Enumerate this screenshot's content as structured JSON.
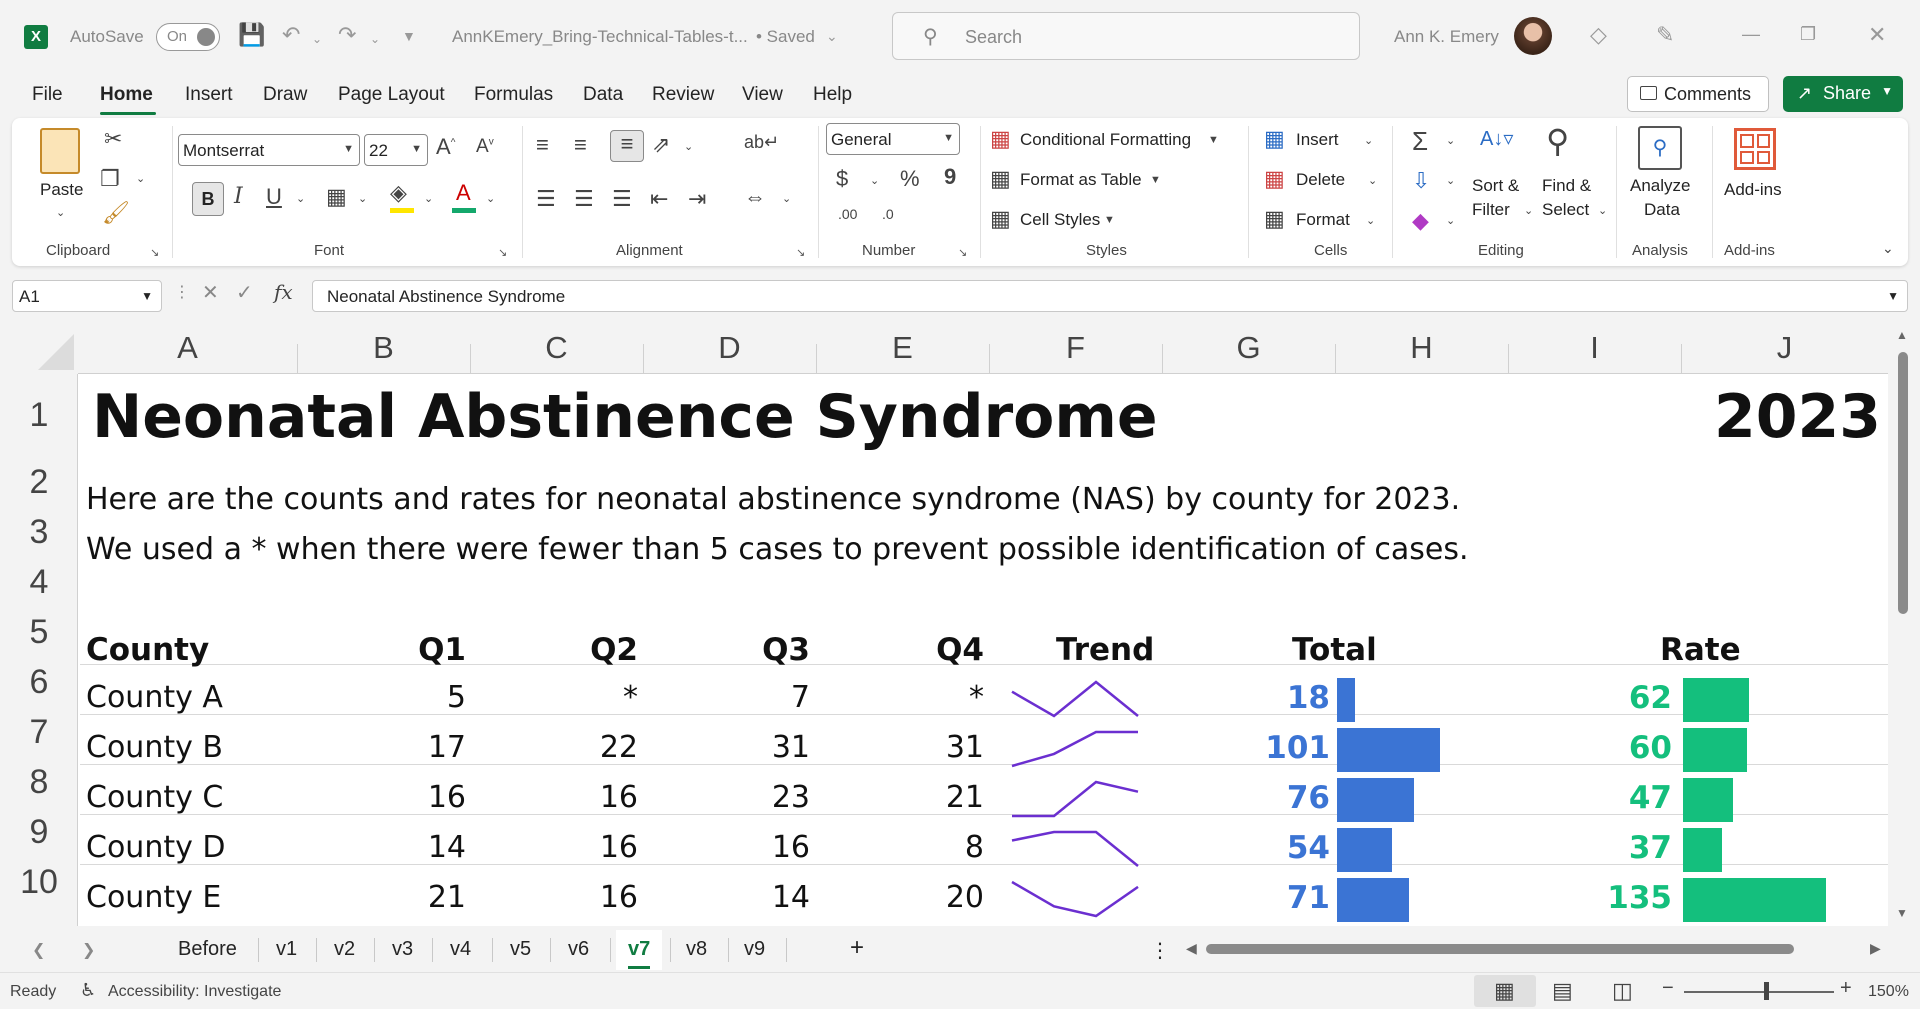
{
  "titlebar": {
    "autosave_label": "AutoSave",
    "autosave_state": "On",
    "filename": "AnnKEmery_Bring-Technical-Tables-t...",
    "save_state": "• Saved",
    "search_placeholder": "Search",
    "user_name": "Ann K. Emery"
  },
  "menu": {
    "items": [
      "File",
      "Home",
      "Insert",
      "Draw",
      "Page Layout",
      "Formulas",
      "Data",
      "Review",
      "View",
      "Help"
    ],
    "active": "Home",
    "comments_label": "Comments",
    "share_label": "Share"
  },
  "ribbon": {
    "clipboard": {
      "paste": "Paste",
      "label": "Clipboard"
    },
    "font": {
      "name": "Montserrat",
      "size": "22",
      "bold": "B",
      "italic": "I",
      "underline": "U",
      "label": "Font"
    },
    "alignment": {
      "label": "Alignment"
    },
    "number": {
      "format": "General",
      "dollar": "$",
      "percent": "%",
      "comma": "9",
      "inc_dec": ".00",
      "dec_dec": ".0",
      "label": "Number"
    },
    "styles": {
      "conditional": "Conditional Formatting",
      "table": "Format as Table",
      "cell_styles": "Cell Styles",
      "label": "Styles"
    },
    "cells": {
      "insert": "Insert",
      "delete": "Delete",
      "format": "Format",
      "label": "Cells"
    },
    "editing": {
      "sort_1": "Sort &",
      "sort_2": "Filter",
      "find_1": "Find &",
      "find_2": "Select",
      "label": "Editing"
    },
    "analysis": {
      "btn_1": "Analyze",
      "btn_2": "Data",
      "label": "Analysis"
    },
    "addins": {
      "btn": "Add-ins",
      "label": "Add-ins"
    }
  },
  "formula_bar": {
    "cell_ref": "A1",
    "fx": "fx",
    "content": "Neonatal Abstinence Syndrome"
  },
  "grid": {
    "columns": [
      "A",
      "B",
      "C",
      "D",
      "E",
      "F",
      "G",
      "H",
      "I",
      "J"
    ],
    "rows": [
      "1",
      "2",
      "3",
      "4",
      "5",
      "6",
      "7",
      "8",
      "9",
      "10"
    ],
    "title": "Neonatal Abstinence Syndrome",
    "year": "2023",
    "line2": "Here are the counts and rates for neonatal abstinence syndrome (NAS) by county for 2023.",
    "line3": "We used a * when there were fewer than 5 cases to prevent possible identification of cases.",
    "headers": {
      "county": "County",
      "q1": "Q1",
      "q2": "Q2",
      "q3": "Q3",
      "q4": "Q4",
      "trend": "Trend",
      "total": "Total",
      "rate": "Rate"
    },
    "colors": {
      "total_bar": "#3b74d4",
      "rate_bar": "#14bf7d",
      "sparkline": "#6b2fd0"
    },
    "table": [
      {
        "county": "County A",
        "q1": "5",
        "q2": "*",
        "q3": "7",
        "q4": "*",
        "total": 18,
        "rate": 62
      },
      {
        "county": "County B",
        "q1": "17",
        "q2": "22",
        "q3": "31",
        "q4": "31",
        "total": 101,
        "rate": 60
      },
      {
        "county": "County C",
        "q1": "16",
        "q2": "16",
        "q3": "23",
        "q4": "21",
        "total": 76,
        "rate": 47
      },
      {
        "county": "County D",
        "q1": "14",
        "q2": "16",
        "q3": "16",
        "q4": "8",
        "total": 54,
        "rate": 37
      },
      {
        "county": "County E",
        "q1": "21",
        "q2": "16",
        "q3": "14",
        "q4": "20",
        "total": 71,
        "rate": 135
      }
    ]
  },
  "sheets": {
    "tabs": [
      "Before",
      "v1",
      "v2",
      "v3",
      "v4",
      "v5",
      "v6",
      "v7",
      "v8",
      "v9"
    ],
    "active": "v7",
    "add": "+"
  },
  "status": {
    "ready": "Ready",
    "accessibility": "Accessibility: Investigate",
    "zoom": "150%"
  }
}
